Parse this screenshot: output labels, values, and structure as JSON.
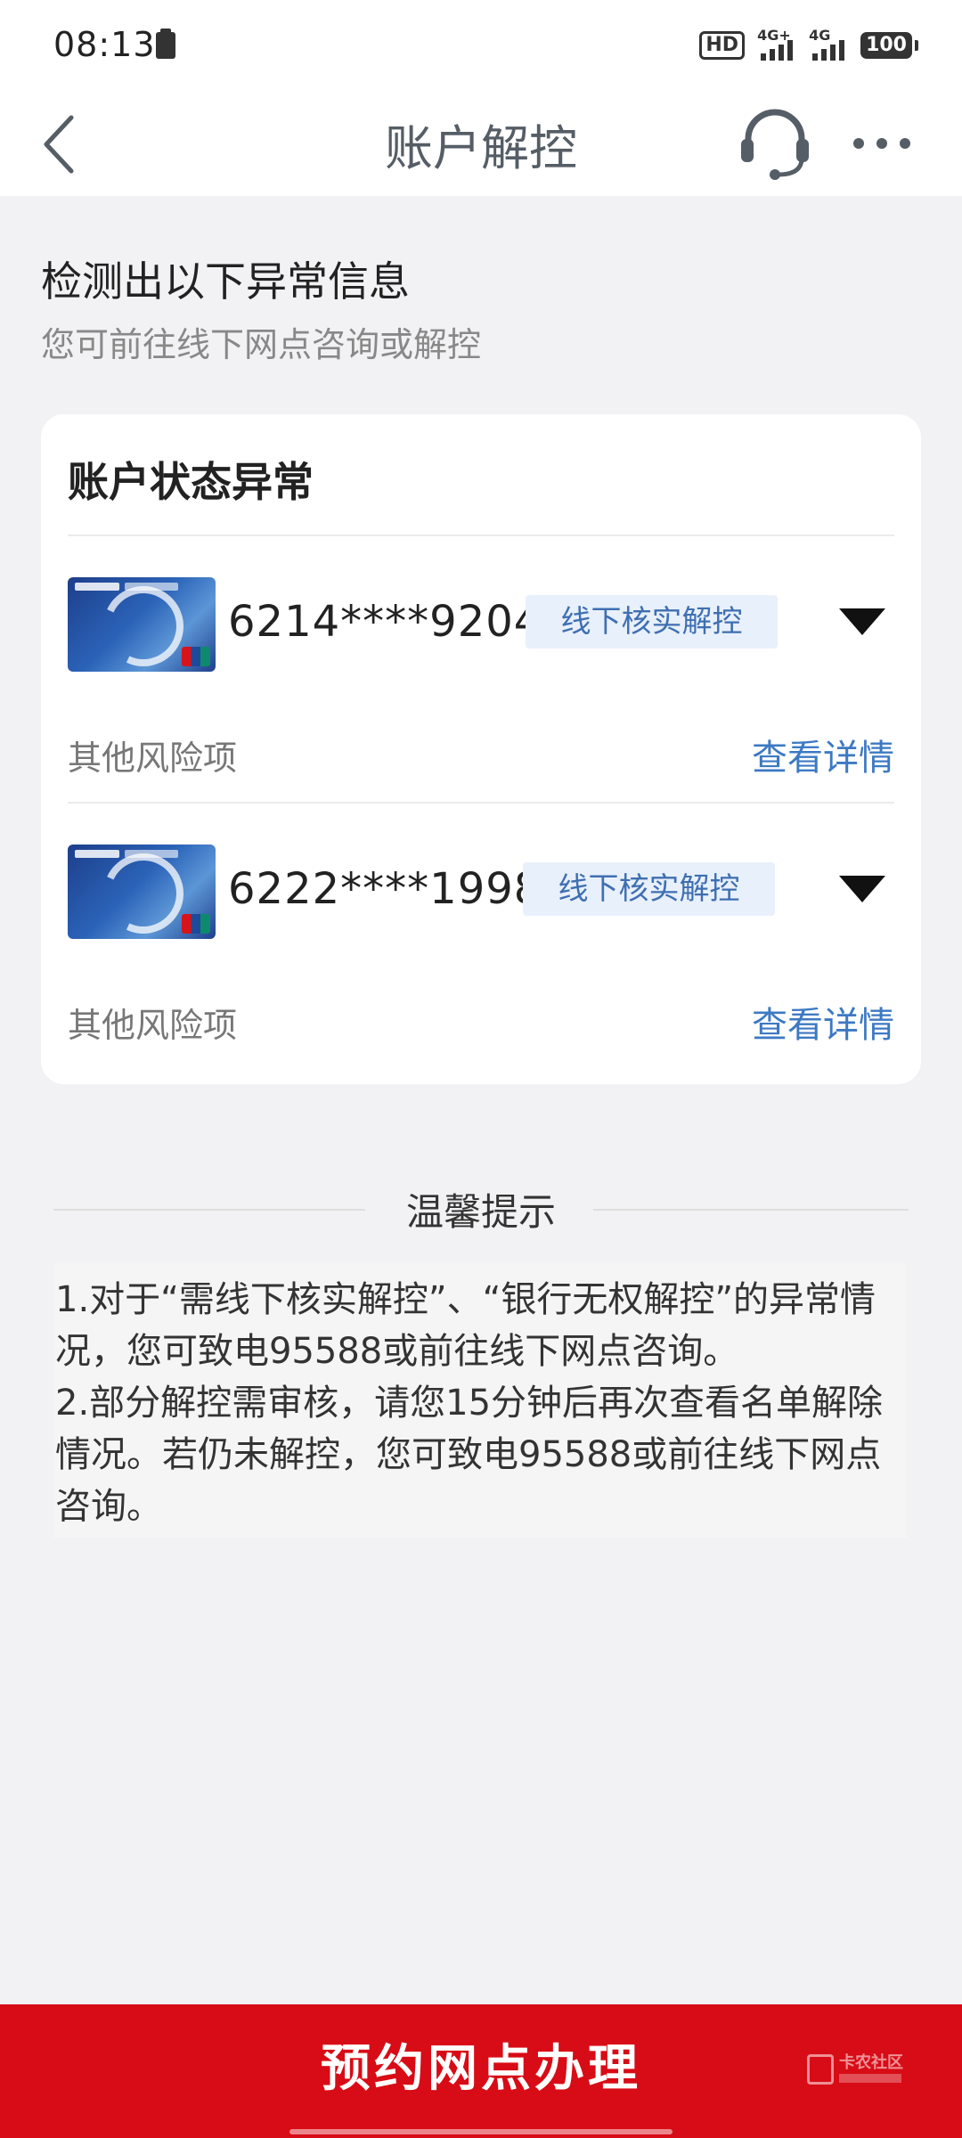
{
  "status_bar": {
    "time": "08:13",
    "hd": "HD",
    "signal1": "4G+",
    "signal2": "4G",
    "battery": "100"
  },
  "nav": {
    "title": "账户解控",
    "back_icon": "chevron-left-icon",
    "service_icon": "headset-icon",
    "more_icon": "more-dots-icon"
  },
  "intro": {
    "title": "检测出以下异常信息",
    "subtitle": "您可前往线下网点咨询或解控"
  },
  "card": {
    "title": "账户状态异常",
    "accounts": [
      {
        "number": "6214****9204",
        "badge": "线下核实解控",
        "risk_label": "其他风险项",
        "detail_link": "查看详情"
      },
      {
        "number": "6222****1998",
        "badge": "线下核实解控",
        "risk_label": "其他风险项",
        "detail_link": "查看详情"
      }
    ]
  },
  "tips": {
    "title": "温馨提示",
    "line1": "1.对于“需线下核实解控”、“银行无权解控”的异常情况，您可致电95588或前往线下网点咨询。",
    "line2": "2.部分解控需审核，请您15分钟后再次查看名单解除情况。若仍未解控，您可致电95588或前往线下网点咨询。"
  },
  "bottom": {
    "button_label": "预约网点办理",
    "watermark": "卡农社区"
  },
  "colors": {
    "primary_red": "#d80c16",
    "link_blue": "#3d79c3",
    "badge_bg": "#e8f0fb",
    "badge_text": "#3f6fb2",
    "page_bg": "#f2f2f4"
  }
}
